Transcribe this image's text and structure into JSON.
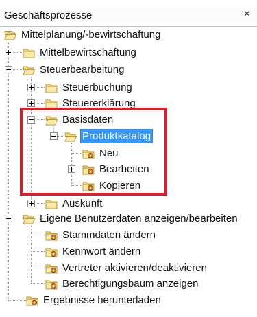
{
  "panel": {
    "title": "Geschäftsprozesse",
    "close_glyph": "×"
  },
  "tree": {
    "mittelplanung": "Mittelplanung/-bewirtschaftung",
    "mittelbewirtschaftung": "Mittelbewirtschaftung",
    "steuerbearbeitung": "Steuerbearbeitung",
    "steuerbuchung": "Steuerbuchung",
    "steuererklaerung": "Steuererklärung",
    "basisdaten": "Basisdaten",
    "produktkatalog": "Produktkatalog",
    "neu": "Neu",
    "bearbeiten": "Bearbeiten",
    "kopieren": "Kopieren",
    "auskunft": "Auskunft",
    "eigene": "Eigene Benutzerdaten anzeigen/bearbeiten",
    "stammdaten": "Stammdaten ändern",
    "kennwort": "Kennwort ändern",
    "vertreter": "Vertreter aktivieren/deaktivieren",
    "berechtigung": "Berechtigungsbaum anzeigen",
    "ergebnisse": "Ergebnisse herunterladen"
  },
  "icons": {
    "open_folder": "open-folder-icon",
    "closed_folder": "closed-folder-icon",
    "process": "folder-gear-icon"
  },
  "colors": {
    "selection": "#3399ff",
    "callout": "#d81e2c",
    "folder": "#f4d67a"
  }
}
